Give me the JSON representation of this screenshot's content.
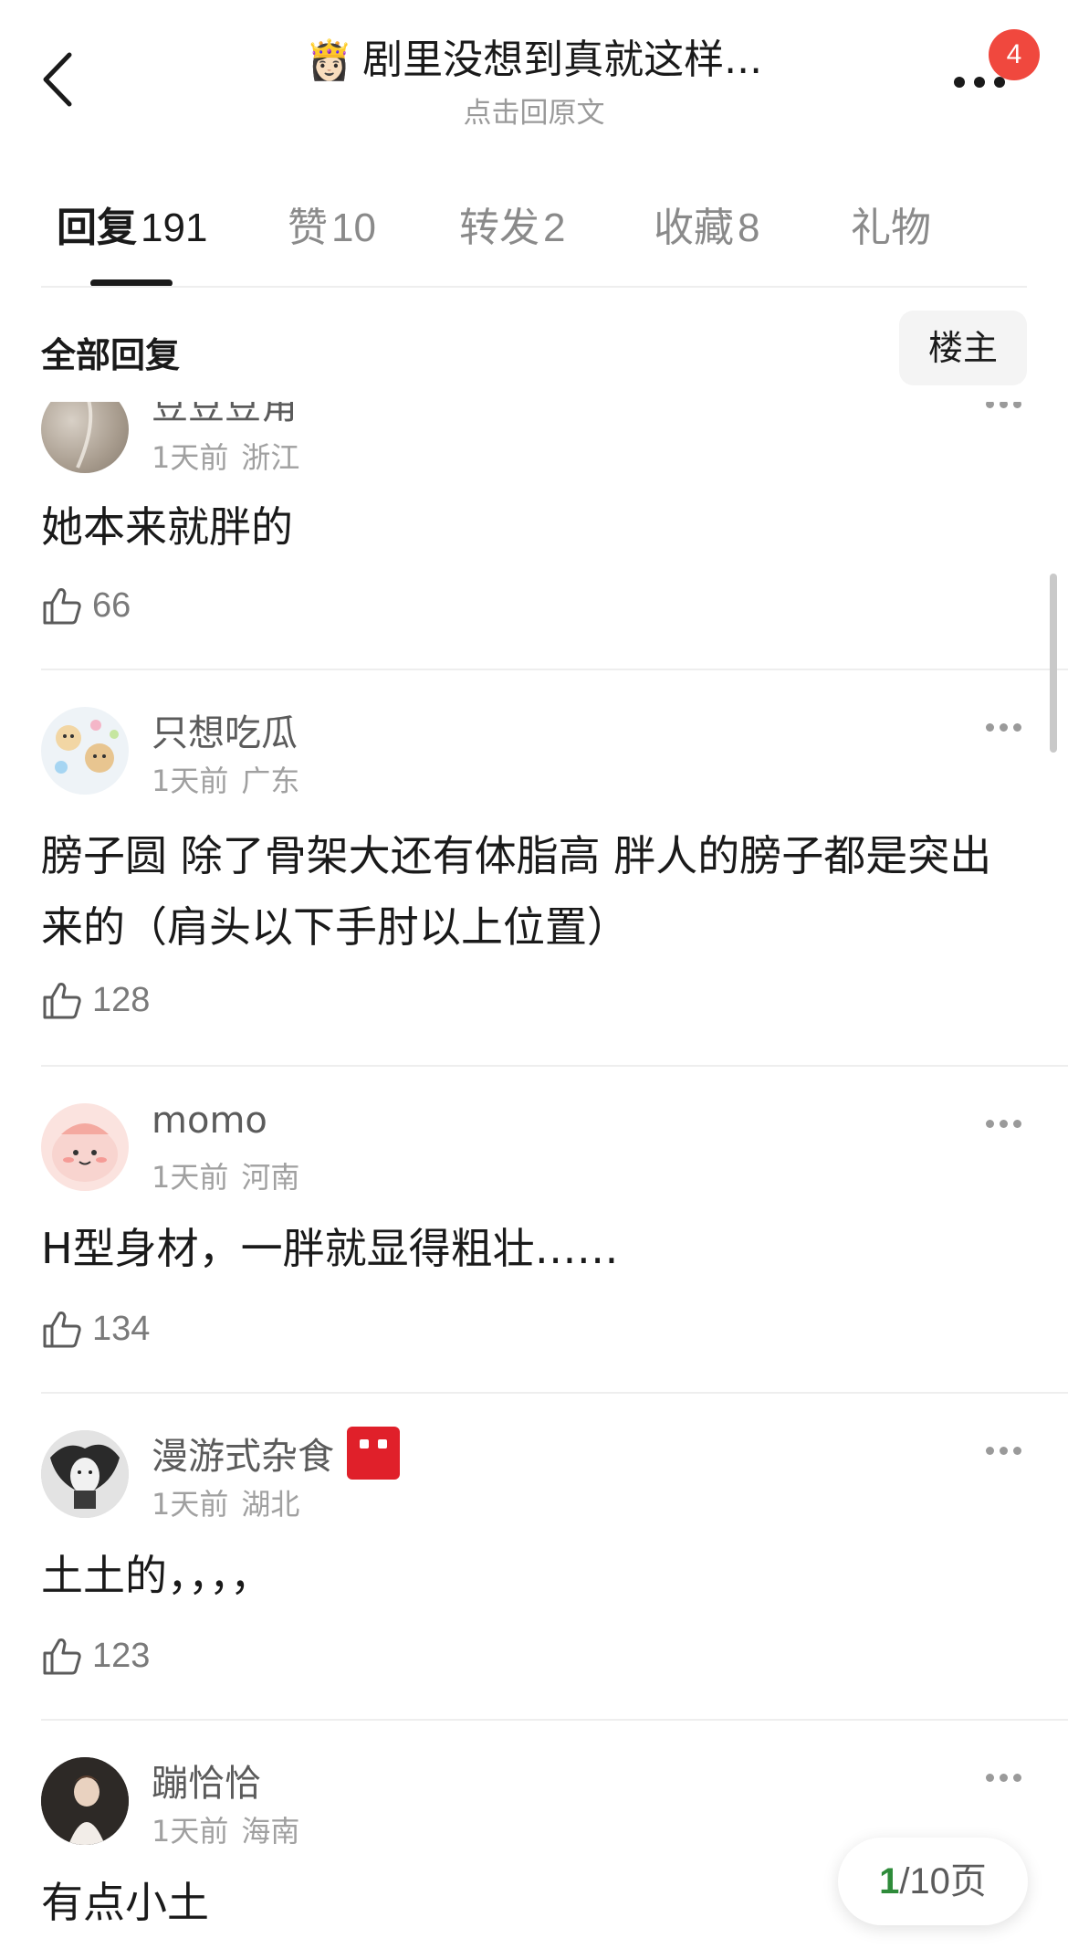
{
  "header": {
    "title": "剧里没想到真就这样...",
    "title_emoji": "👸🏻",
    "subtitle": "点击回原文",
    "notification_count": "4"
  },
  "tabs": [
    {
      "label": "回复",
      "count": "191",
      "active": true
    },
    {
      "label": "赞",
      "count": "10",
      "active": false
    },
    {
      "label": "转发",
      "count": "2",
      "active": false
    },
    {
      "label": "收藏",
      "count": "8",
      "active": false
    },
    {
      "label": "礼物",
      "count": "",
      "active": false
    }
  ],
  "section": {
    "title": "全部回复",
    "filter_label": "楼主"
  },
  "comments": [
    {
      "username": "豆豆豆角",
      "time": "1天前",
      "location": "浙江",
      "text": "她本来就胖的",
      "likes": "66"
    },
    {
      "username": "只想吃瓜",
      "time": "1天前",
      "location": "广东",
      "text": "膀子圆 除了骨架大还有体脂高 胖人的膀子都是突出来的（肩头以下手肘以上位置）",
      "likes": "128"
    },
    {
      "username": "momo",
      "time": "1天前",
      "location": "河南",
      "text": "H型身材，一胖就显得粗壮……",
      "likes": "134"
    },
    {
      "username": "漫游式杂食",
      "time": "1天前",
      "location": "湖北",
      "text": "土土的，，，，",
      "likes": "123"
    },
    {
      "username": "蹦恰恰",
      "time": "1天前",
      "location": "海南",
      "text": "有点小土",
      "likes": ""
    }
  ],
  "pagination": {
    "current": "1",
    "total_text": "/10页"
  },
  "colors": {
    "badge_red": "#f0483e",
    "page_current_green": "#2e8b3a",
    "username_gray": "#5b5b5b",
    "meta_gray": "#a0a0a0"
  }
}
